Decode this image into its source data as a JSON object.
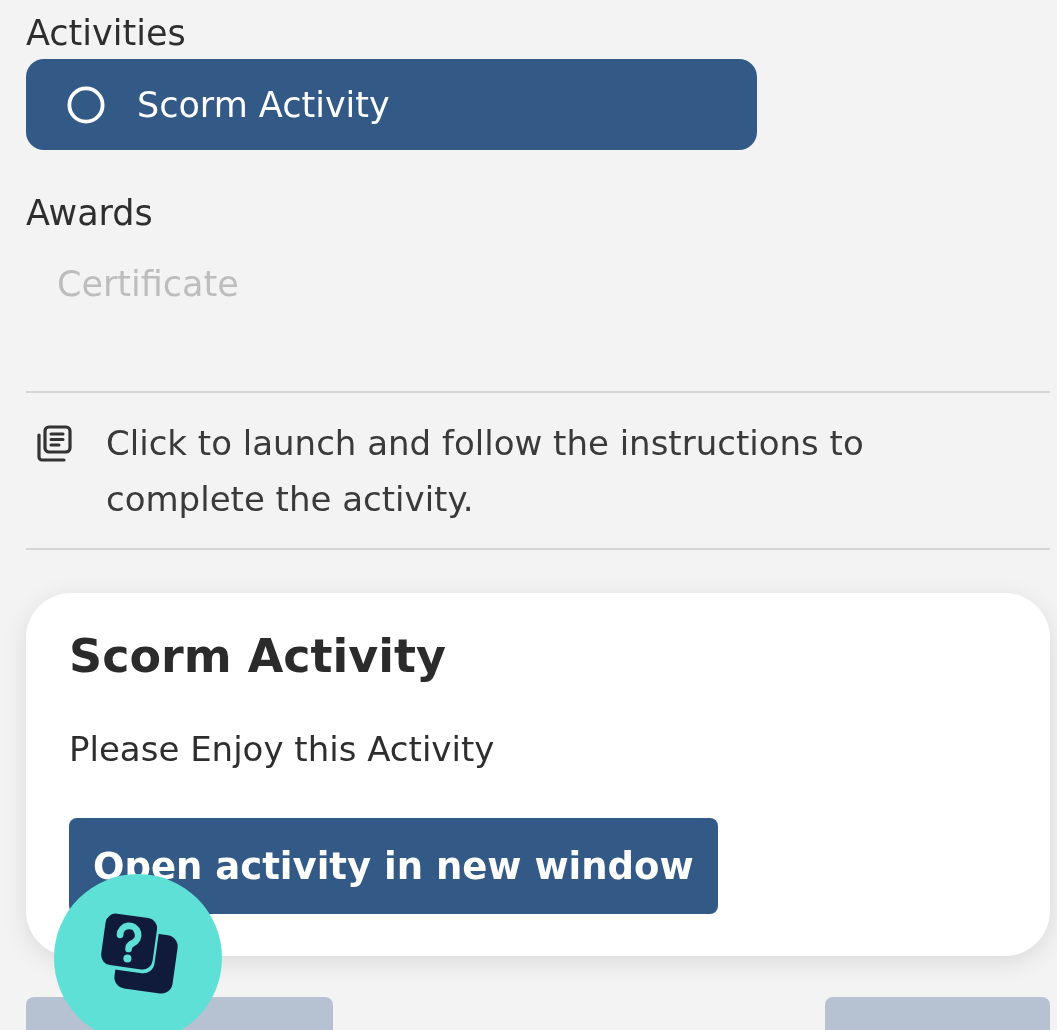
{
  "activities": {
    "heading": "Activities",
    "items": [
      {
        "label": "Scorm Activity",
        "selected": true,
        "completed": false
      }
    ]
  },
  "awards": {
    "heading": "Awards",
    "items": [
      {
        "label": "Certificate",
        "earned": false
      }
    ]
  },
  "instructions": {
    "text": "Click to launch and follow the instructions to complete the activity."
  },
  "activity_card": {
    "title": "Scorm Activity",
    "description": "Please Enjoy this Activity",
    "button": "Open activity in new window"
  },
  "footer_buttons": [
    {
      "disabled": true
    },
    {
      "disabled": true
    }
  ]
}
